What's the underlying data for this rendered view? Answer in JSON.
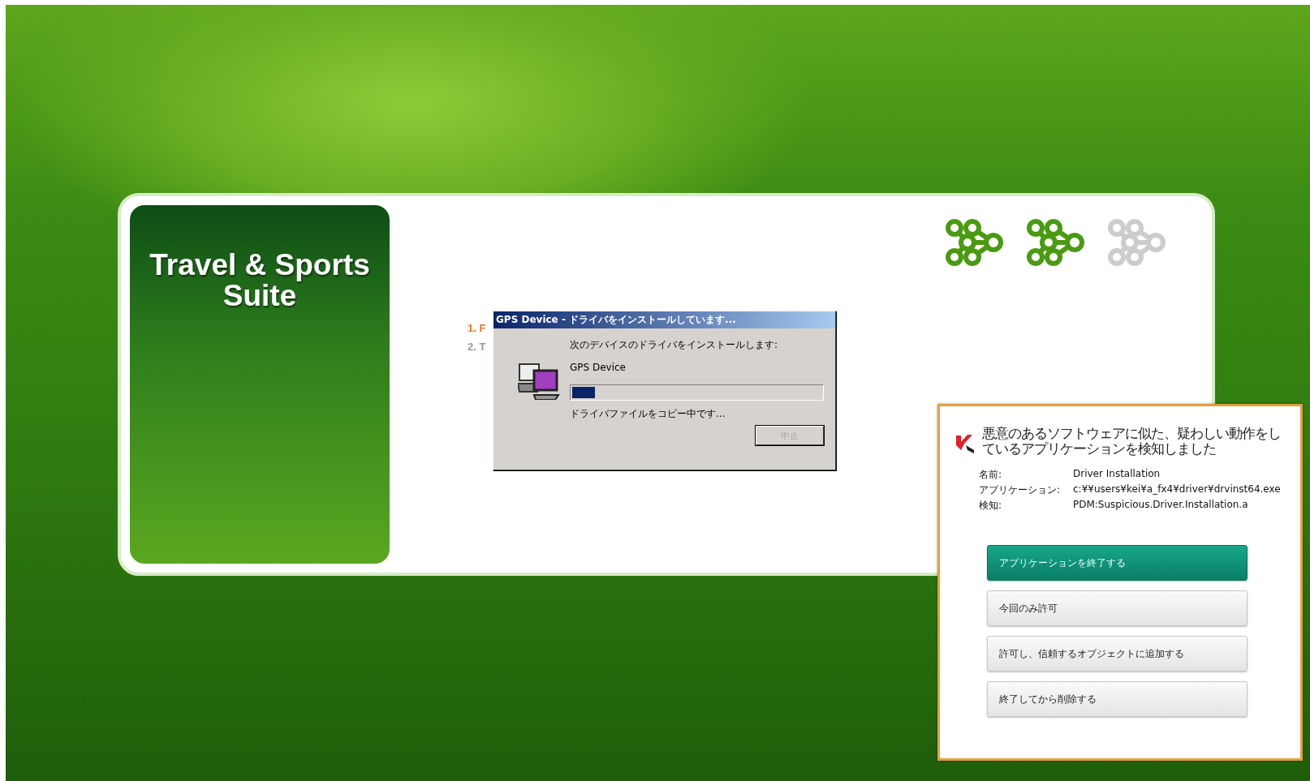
{
  "product": {
    "title": "Travel & Sports Suite"
  },
  "progress_steps": [
    {
      "done": true
    },
    {
      "done": true
    },
    {
      "done": false
    }
  ],
  "steps": [
    {
      "label": "1. F",
      "current": true
    },
    {
      "label": "2. T",
      "current": false
    }
  ],
  "install_dialog": {
    "title": "GPS Device - ドライバをインストールしています...",
    "message": "次のデバイスのドライバをインストールします:",
    "device": "GPS Device",
    "level": 0.09,
    "status": "ドライバファイルをコピー中です...",
    "cancel": {
      "label": "中止",
      "disabled": true
    }
  },
  "security_alert": {
    "heading": "悪意のあるソフトウェアに似た、疑わしい動作をしているアプリケーションを検知しました",
    "details": [
      {
        "label": "名前:",
        "value": "Driver Installation"
      },
      {
        "label": "アプリケーション:",
        "value": "c:¥¥users¥kei¥a_fx4¥driver¥drvinst64.exe"
      },
      {
        "label": "検知:",
        "value": "PDM:Suspicious.Driver.Installation.a"
      }
    ],
    "actions": [
      {
        "label": "アプリケーションを終了する",
        "primary": true
      },
      {
        "label": "今回のみ許可",
        "primary": false
      },
      {
        "label": "許可し、信頼するオブジェクトに追加する",
        "primary": false
      },
      {
        "label": "終了してから削除する",
        "primary": false
      }
    ]
  }
}
